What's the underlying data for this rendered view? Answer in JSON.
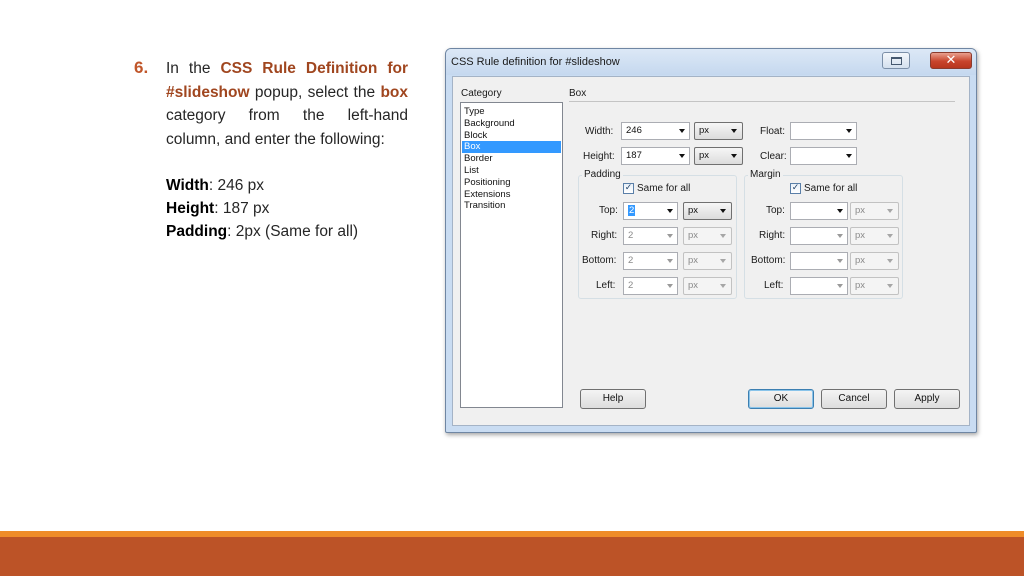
{
  "slide": {
    "step_number": "6.",
    "intro_1": "In the ",
    "highlight_1": "CSS Rule Definition for #slideshow",
    "intro_2": " popup, select the ",
    "highlight_2": "box",
    "intro_3": " category from the left-hand column, and enter the following:",
    "lines": [
      {
        "key": "Width",
        "value": ": 246 px"
      },
      {
        "key": "Height",
        "value": ": 187 px"
      },
      {
        "key": "Padding",
        "value": ": 2px (Same for all)"
      }
    ]
  },
  "colors": {
    "accent_text": "#a0461f",
    "bar_thin": "#ef8c29",
    "bar_thick": "#bc5327",
    "selection": "#3399ff"
  },
  "dialog": {
    "title": "CSS Rule definition for #slideshow",
    "close_glyph": "✕",
    "category_label": "Category",
    "section_label": "Box",
    "categories": [
      "Type",
      "Background",
      "Block",
      "Box",
      "Border",
      "List",
      "Positioning",
      "Extensions",
      "Transition"
    ],
    "selected_category": "Box",
    "width": {
      "label": "Width:",
      "value": "246",
      "unit": "px"
    },
    "height": {
      "label": "Height:",
      "value": "187",
      "unit": "px"
    },
    "float": {
      "label": "Float:",
      "value": ""
    },
    "clear": {
      "label": "Clear:",
      "value": ""
    },
    "padding": {
      "title": "Padding",
      "same_for_all": "Same for all",
      "top": {
        "label": "Top:",
        "value": "2",
        "unit": "px"
      },
      "right": {
        "label": "Right:",
        "value": "2",
        "unit": "px"
      },
      "bottom": {
        "label": "Bottom:",
        "value": "2",
        "unit": "px"
      },
      "left": {
        "label": "Left:",
        "value": "2",
        "unit": "px"
      }
    },
    "margin": {
      "title": "Margin",
      "same_for_all": "Same for all",
      "top": {
        "label": "Top:",
        "value": "",
        "unit": "px"
      },
      "right": {
        "label": "Right:",
        "value": "",
        "unit": "px"
      },
      "bottom": {
        "label": "Bottom:",
        "value": "",
        "unit": "px"
      },
      "left": {
        "label": "Left:",
        "value": "",
        "unit": "px"
      }
    },
    "buttons": {
      "help": "Help",
      "ok": "OK",
      "cancel": "Cancel",
      "apply": "Apply"
    }
  }
}
